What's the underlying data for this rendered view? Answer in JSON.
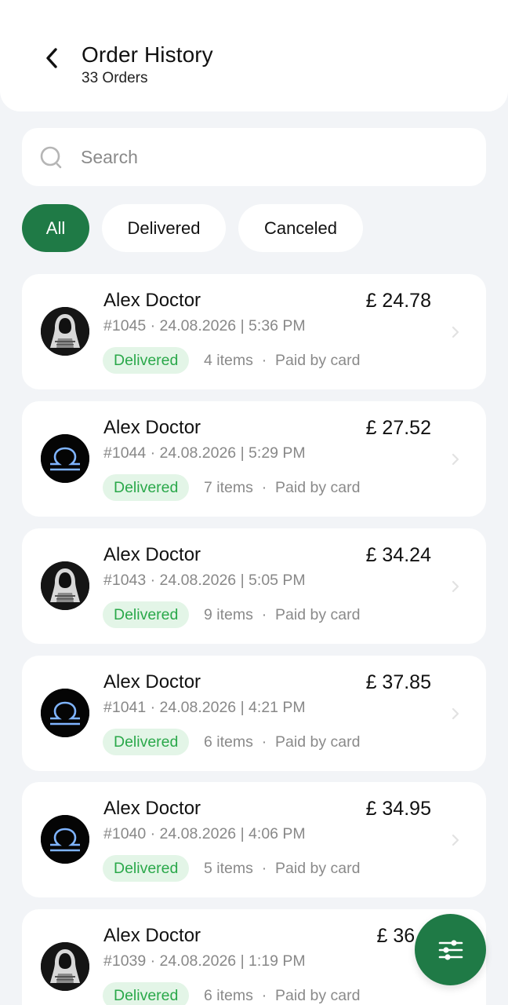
{
  "header": {
    "title": "Order History",
    "subtitle": "33 Orders"
  },
  "search": {
    "placeholder": "Search",
    "value": ""
  },
  "filters": [
    {
      "label": "All",
      "active": true
    },
    {
      "label": "Delivered",
      "active": false
    },
    {
      "label": "Canceled",
      "active": false
    }
  ],
  "orders": [
    {
      "customer": "Alex Doctor",
      "price": "£ 24.78",
      "meta": "#1045 · 24.08.2026 | 5:36 PM",
      "status": "Delivered",
      "items": "4 items",
      "payment": "Paid by card",
      "avatar": "hooded-figure-avatar"
    },
    {
      "customer": "Alex Doctor",
      "price": "£ 27.52",
      "meta": "#1044 · 24.08.2026 | 5:29 PM",
      "status": "Delivered",
      "items": "7 items",
      "payment": "Paid by card",
      "avatar": "libra-symbol-avatar"
    },
    {
      "customer": "Alex Doctor",
      "price": "£ 34.24",
      "meta": "#1043 · 24.08.2026 | 5:05 PM",
      "status": "Delivered",
      "items": "9 items",
      "payment": "Paid by card",
      "avatar": "hooded-figure-avatar"
    },
    {
      "customer": "Alex Doctor",
      "price": "£ 37.85",
      "meta": "#1041 · 24.08.2026 | 4:21 PM",
      "status": "Delivered",
      "items": "6 items",
      "payment": "Paid by card",
      "avatar": "libra-symbol-avatar"
    },
    {
      "customer": "Alex Doctor",
      "price": "£ 34.95",
      "meta": "#1040 · 24.08.2026 | 4:06 PM",
      "status": "Delivered",
      "items": "5 items",
      "payment": "Paid by card",
      "avatar": "libra-symbol-avatar"
    },
    {
      "customer": "Alex Doctor",
      "price": "£ 36.2",
      "meta": "#1039 · 24.08.2026 | 1:19 PM",
      "status": "Delivered",
      "items": "6 items",
      "payment": "Paid by card",
      "avatar": "hooded-figure-avatar"
    }
  ],
  "separator": "·",
  "icons": {
    "back": "chevron-left-icon",
    "search": "search-icon",
    "row_chevron": "chevron-right-icon",
    "fab": "filter-sliders-icon"
  },
  "colors": {
    "accent": "#1f7a46",
    "badge_bg": "#e3f5e7",
    "badge_text": "#2aa84a",
    "background": "#f2f4f7"
  }
}
